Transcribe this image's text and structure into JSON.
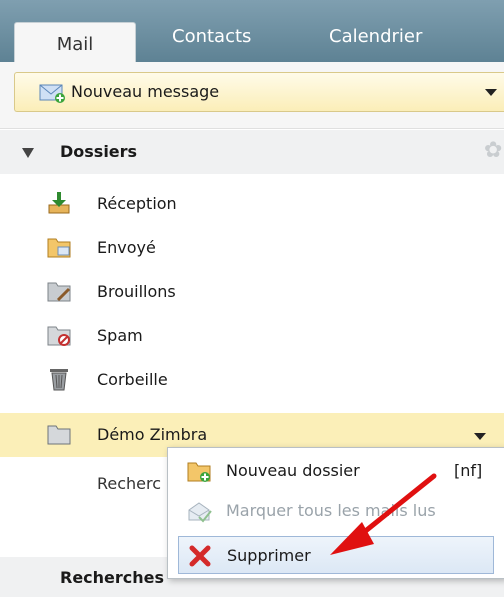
{
  "tabs": {
    "mail": "Mail",
    "contacts": "Contacts",
    "calendar": "Calendrier"
  },
  "toolbar": {
    "new_message": "Nouveau message"
  },
  "folders": {
    "header": "Dossiers",
    "items": [
      {
        "label": "Réception",
        "icon": "inbox-icon"
      },
      {
        "label": "Envoyé",
        "icon": "sent-folder-icon"
      },
      {
        "label": "Brouillons",
        "icon": "drafts-icon"
      },
      {
        "label": "Spam",
        "icon": "spam-folder-icon"
      },
      {
        "label": "Corbeille",
        "icon": "trash-icon"
      },
      {
        "label": "Démo Zimbra",
        "icon": "folder-icon"
      }
    ],
    "search_row": "Recherc"
  },
  "searches": {
    "header": "Recherches"
  },
  "context_menu": {
    "items": [
      {
        "label": "Nouveau dossier",
        "shortcut": "[nf]",
        "icon": "new-folder-icon"
      },
      {
        "label": "Marquer tous les mails lus",
        "icon": "mark-read-icon"
      },
      {
        "label": "Supprimer",
        "icon": "delete-x-icon"
      }
    ]
  },
  "colors": {
    "tabbar": "#6b8ea0",
    "selected_row": "#fbefb8",
    "annotation_arrow": "#e01010"
  }
}
